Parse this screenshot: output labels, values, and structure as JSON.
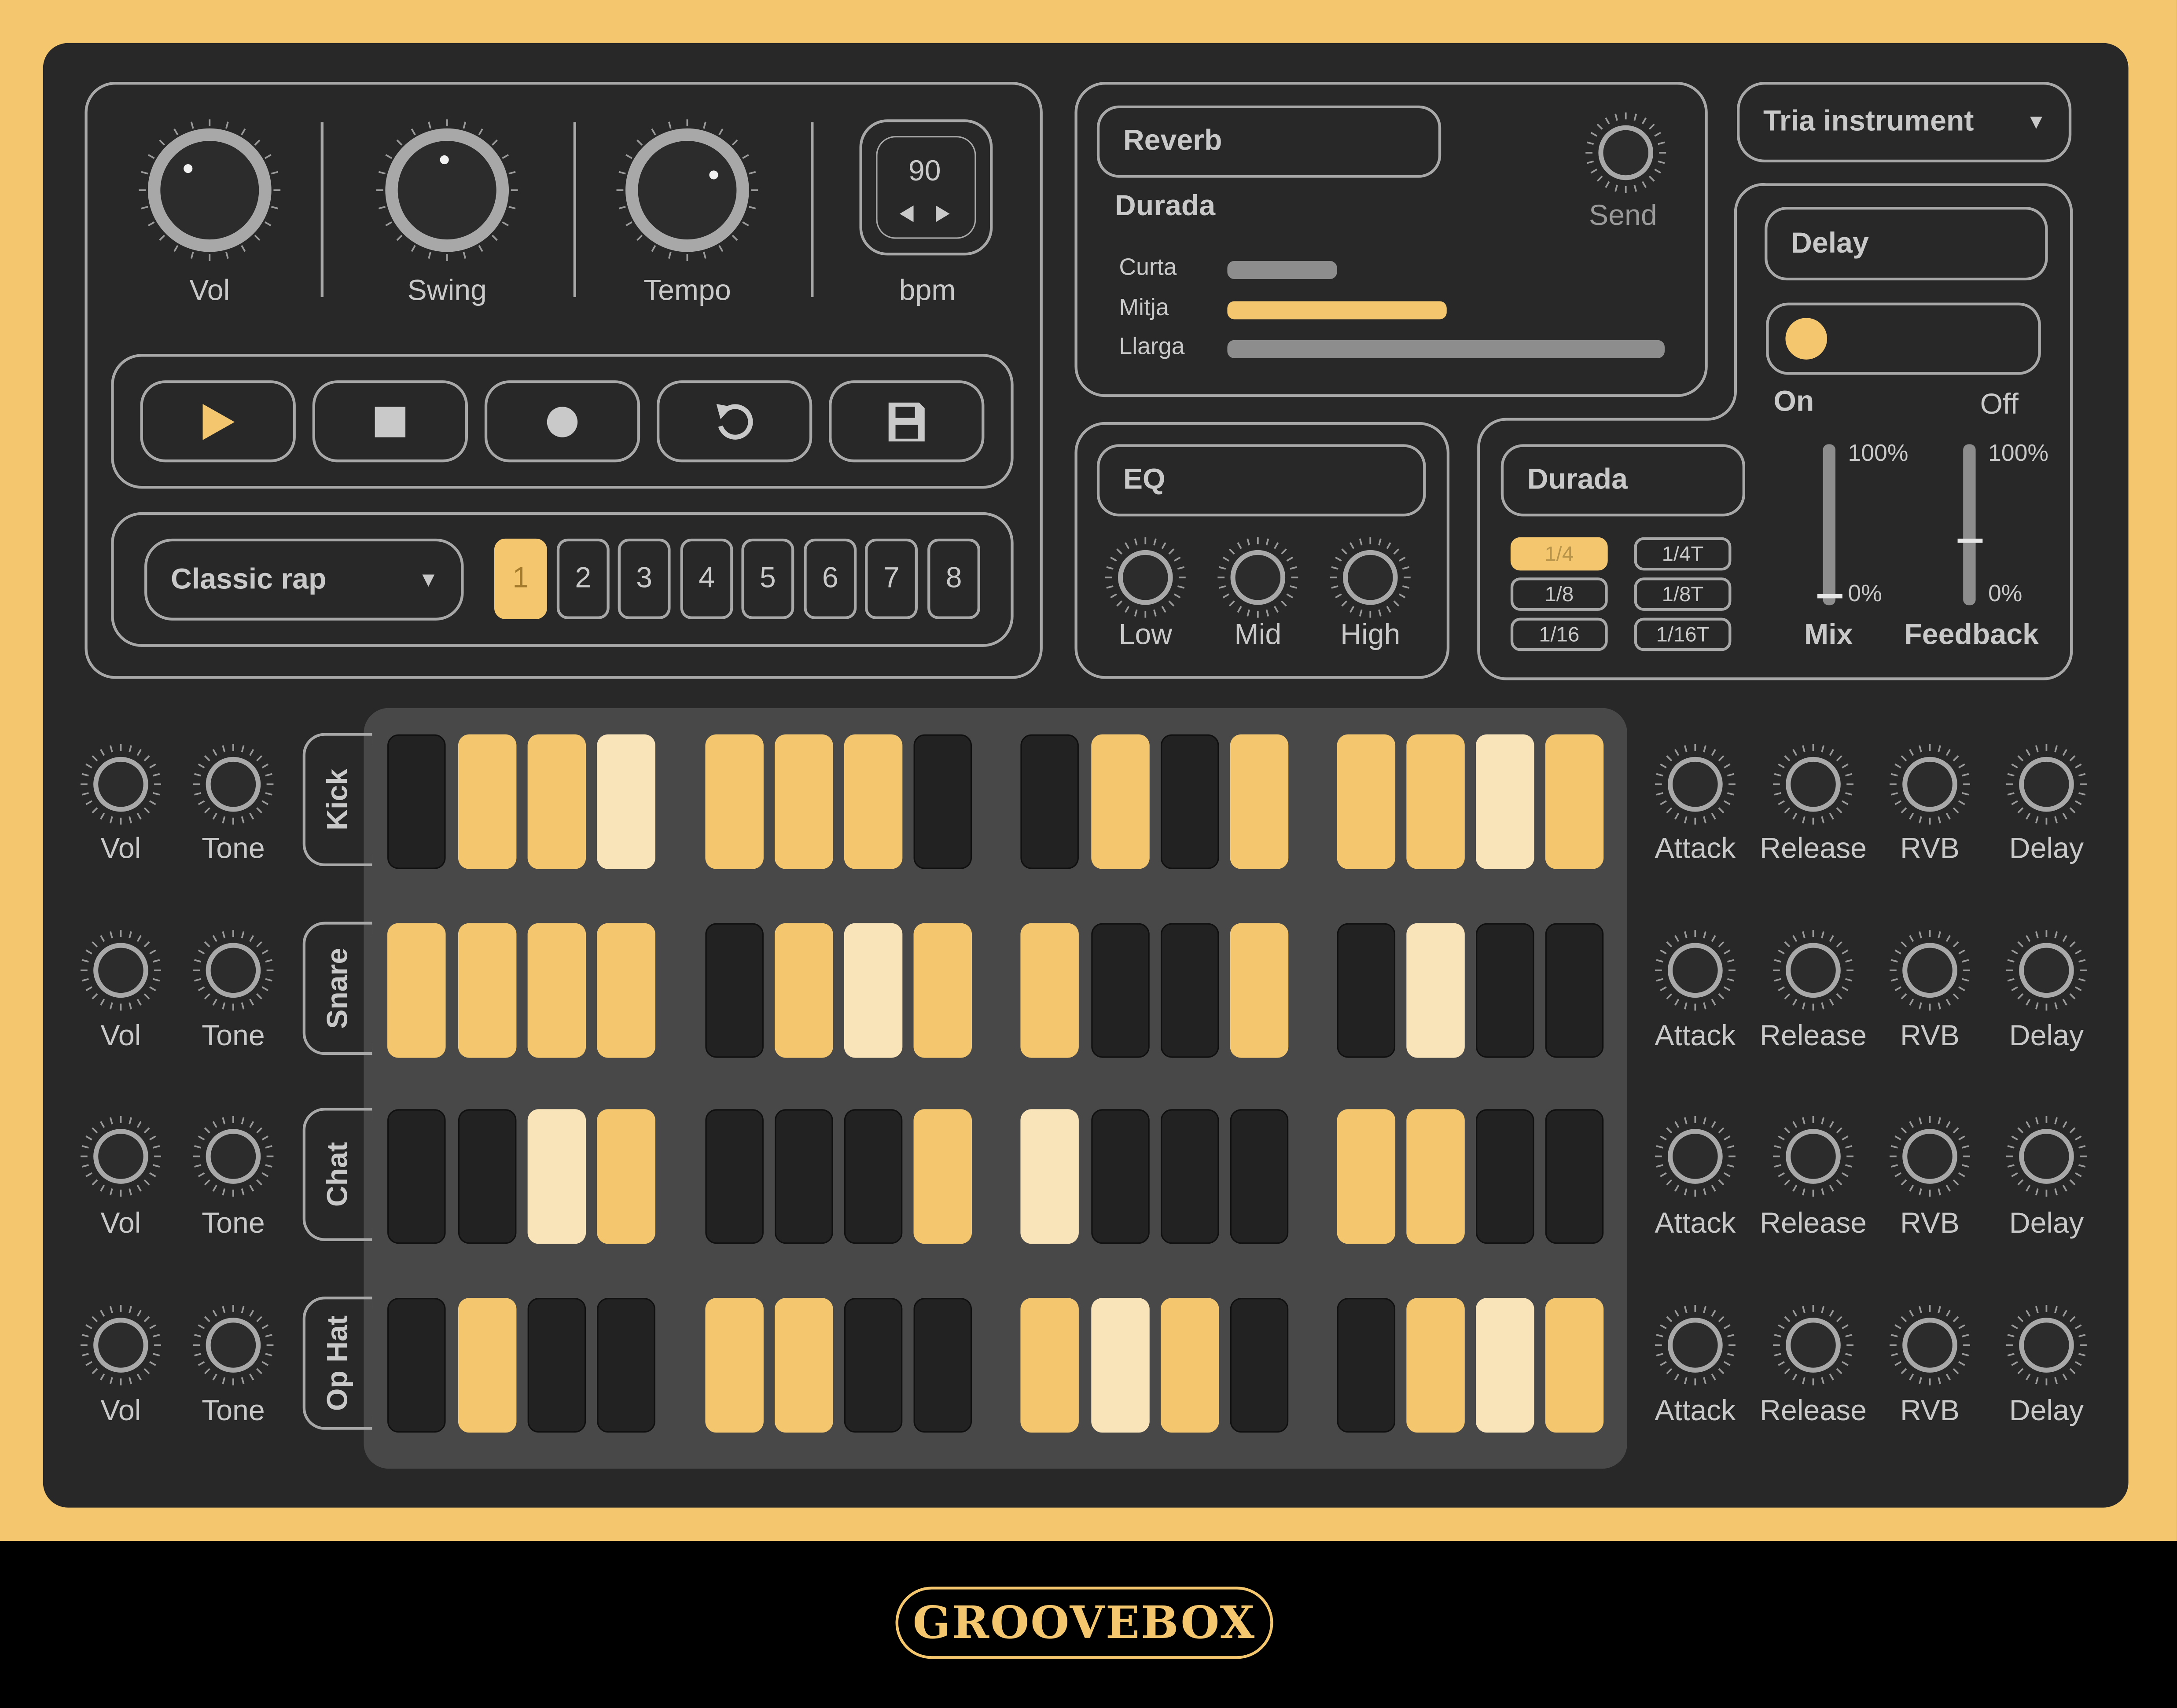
{
  "colors": {
    "frame": "#f4c76e",
    "panel": "#282829",
    "accent": "#f4c76e",
    "accent_light": "#f9e3b8",
    "stroke": "#a8a8a8",
    "text": "#c9c9c9"
  },
  "transport": {
    "knobs": [
      {
        "label": "Vol"
      },
      {
        "label": "Swing"
      },
      {
        "label": "Tempo"
      }
    ],
    "bpm": {
      "value": "90",
      "label": "bpm"
    },
    "buttons": [
      {
        "icon": "play-icon"
      },
      {
        "icon": "stop-icon"
      },
      {
        "icon": "record-icon"
      },
      {
        "icon": "loop-icon"
      },
      {
        "icon": "save-icon"
      }
    ],
    "preset": {
      "value": "Classic rap"
    },
    "patterns": [
      "1",
      "2",
      "3",
      "4",
      "5",
      "6",
      "7",
      "8"
    ],
    "active_pattern": "1"
  },
  "reverb": {
    "title": "Reverb",
    "send_label": "Send",
    "duration_label": "Durada",
    "options": [
      {
        "label": "Curta",
        "level": 0.25
      },
      {
        "label": "Mitja",
        "level": 0.5
      },
      {
        "label": "Llarga",
        "level": 1.0
      }
    ],
    "selected": "Mitja"
  },
  "instrument_select": {
    "value": "Tria instrument"
  },
  "delay": {
    "title": "Delay",
    "toggle_on": "On",
    "toggle_off": "Off",
    "state": "On",
    "duration_label": "Durada",
    "divisions": [
      "1/4",
      "1/4T",
      "1/8",
      "1/8T",
      "1/16",
      "1/16T"
    ],
    "selected_division": "1/4",
    "faders": [
      {
        "label": "Mix",
        "max": "100%",
        "min": "0%",
        "level": 0.0
      },
      {
        "label": "Feedback",
        "max": "100%",
        "min": "0%",
        "level": 0.4
      }
    ]
  },
  "eq": {
    "title": "EQ",
    "bands": [
      "Low",
      "Mid",
      "High"
    ]
  },
  "tracks": [
    {
      "name": "Kick",
      "left_knobs": [
        "Vol",
        "Tone"
      ],
      "right_knobs": [
        "Attack",
        "Release",
        "RVB",
        "Delay"
      ],
      "steps": [
        0,
        1,
        1,
        2,
        1,
        1,
        1,
        0,
        0,
        1,
        0,
        1,
        1,
        1,
        2,
        1
      ]
    },
    {
      "name": "Snare",
      "left_knobs": [
        "Vol",
        "Tone"
      ],
      "right_knobs": [
        "Attack",
        "Release",
        "RVB",
        "Delay"
      ],
      "steps": [
        1,
        1,
        1,
        1,
        0,
        1,
        2,
        1,
        1,
        0,
        0,
        1,
        0,
        2,
        0,
        0
      ]
    },
    {
      "name": "Chat",
      "left_knobs": [
        "Vol",
        "Tone"
      ],
      "right_knobs": [
        "Attack",
        "Release",
        "RVB",
        "Delay"
      ],
      "steps": [
        0,
        0,
        2,
        1,
        0,
        0,
        0,
        1,
        2,
        0,
        0,
        0,
        1,
        1,
        0,
        0
      ]
    },
    {
      "name": "Op Hat",
      "left_knobs": [
        "Vol",
        "Tone"
      ],
      "right_knobs": [
        "Attack",
        "Release",
        "RVB",
        "Delay"
      ],
      "steps": [
        0,
        1,
        0,
        0,
        1,
        1,
        0,
        0,
        1,
        2,
        1,
        0,
        0,
        1,
        2,
        1
      ]
    }
  ],
  "brand": "GROOVEBOX"
}
